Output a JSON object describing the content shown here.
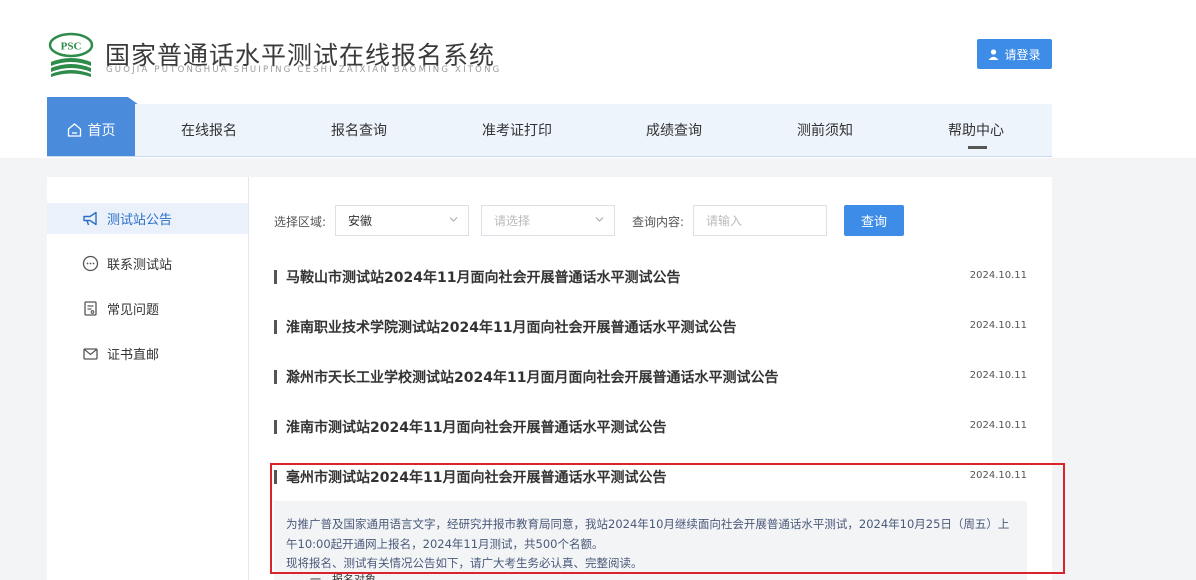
{
  "header": {
    "logo_badge": "PSC",
    "title": "国家普通话水平测试在线报名系统",
    "subtitle": "GUOJIA PUTONGHUA SHUIPING CESHI ZAIXIAN BAOMING XITONG",
    "login_label": "请登录"
  },
  "nav": {
    "items": [
      "首页",
      "在线报名",
      "报名查询",
      "准考证打印",
      "成绩查询",
      "测前须知",
      "帮助中心"
    ],
    "active": "首页"
  },
  "sidebar": {
    "items": [
      {
        "label": "测试站公告",
        "icon": "megaphone-icon"
      },
      {
        "label": "联系测试站",
        "icon": "chat-icon"
      },
      {
        "label": "常见问题",
        "icon": "document-icon"
      },
      {
        "label": "证书直邮",
        "icon": "mail-icon"
      }
    ]
  },
  "filters": {
    "region_label": "选择区域:",
    "province_value": "安徽",
    "city_placeholder": "请选择",
    "query_label": "查询内容:",
    "query_placeholder": "请输入",
    "search_label": "查询"
  },
  "notices": [
    {
      "title": "马鞍山市测试站2024年11月面向社会开展普通话水平测试公告",
      "date": "2024.10.11"
    },
    {
      "title": "淮南职业技术学院测试站2024年11月面向社会开展普通话水平测试公告",
      "date": "2024.10.11"
    },
    {
      "title": "滁州市天长工业学校测试站2024年11月面月面向社会开展普通话水平测试公告",
      "date": "2024.10.11"
    },
    {
      "title": "淮南市测试站2024年11月面向社会开展普通话水平测试公告",
      "date": "2024.10.11"
    },
    {
      "title": "亳州市测试站2024年11月面向社会开展普通话水平测试公告",
      "date": "2024.10.11"
    }
  ],
  "summary": {
    "line1": "为推广普及国家通用语言文字，经研究并报市教育局同意，我站2024年10月继续面向社会开展普通话水平测试，2024年10月25日（周五）上",
    "line2": "午10:00起开通网上报名，2024年11月测试，共500个名额。",
    "line3": "现将报名、测试有关情况公告如下，请广大考生务必认真、完整阅读。",
    "line4": "一、报名对象"
  },
  "colors": {
    "accent": "#3d8ce7",
    "nav_active": "#4a8bdc",
    "highlight": "#d9242b"
  }
}
